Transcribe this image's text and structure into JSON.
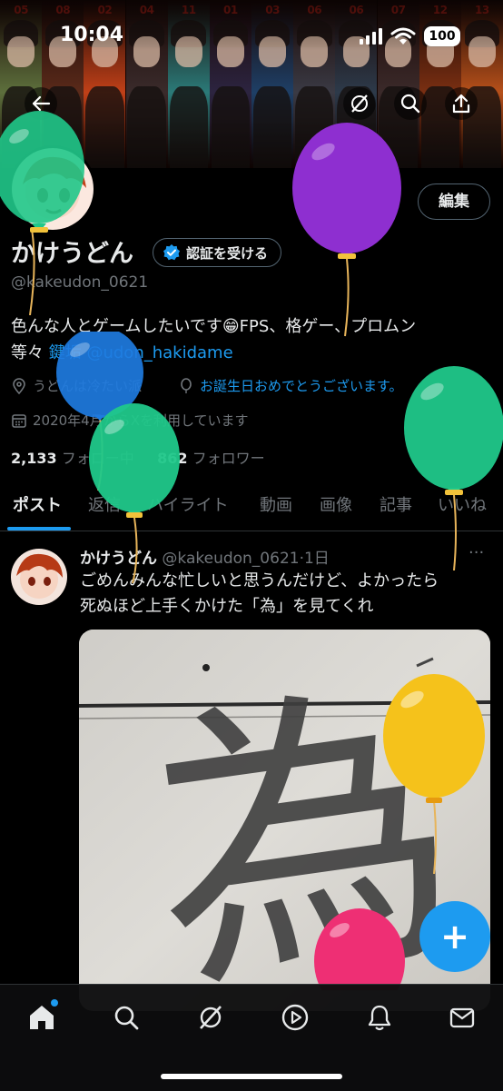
{
  "status_bar": {
    "time": "10:04",
    "battery": "100"
  },
  "banner": {
    "numbers": [
      "05",
      "08",
      "02",
      "04",
      "11",
      "01",
      "03",
      "06",
      "06",
      "07",
      "12",
      "13"
    ],
    "colors": [
      "#5d6f3c",
      "#5a2a1a",
      "#c04018",
      "#3a2b2b",
      "#2b7a78",
      "#2c2440",
      "#1e3f66",
      "#3a3a44",
      "#2d3a4a",
      "#3b2a2a",
      "#7a2f12",
      "#b6501a"
    ]
  },
  "header_icons": [
    "back-arrow-icon",
    "grok-icon",
    "search-icon",
    "share-icon"
  ],
  "profile": {
    "edit_label": "編集",
    "display_name": "かけうどん",
    "verify_label": "認証を受ける",
    "handle": "@kakeudon_0621",
    "bio_line1": "色んな人とゲームしたいです😁FPS、格ゲー、プロムン",
    "bio_line2_prefix": "等々 ",
    "bio_link1": "鍵垢",
    "bio_link2": "@udon_hakidame",
    "location": "うどんは冷たい派",
    "birthday": "お誕生日おめでとうございます。",
    "joined": "2020年4月からXを利用しています",
    "following_count": "2,133",
    "following_label": "フォロー中",
    "followers_count": "862",
    "followers_label": "フォロワー"
  },
  "tabs": [
    "ポスト",
    "返信",
    "ハイライト",
    "動画",
    "画像",
    "記事",
    "いいね"
  ],
  "active_tab": "ポスト",
  "post": {
    "name": "かけうどん",
    "handle": "@kakeudon_0621",
    "time": "·1日",
    "more": "···",
    "text_line1": "ごめんみんな忙しいと思うんだけど、よかったら",
    "text_line2": "死ぬほど上手くかけた「為」を見てくれ",
    "image_character": "為"
  },
  "fab_label": "+",
  "nav": [
    "home-icon",
    "search-icon",
    "grok-icon",
    "video-icon",
    "notifications-icon",
    "messages-icon"
  ],
  "balloon_colors": {
    "green": "#20c88a",
    "purple": "#8e2fd0",
    "blue": "#1e7be0",
    "yellow": "#f5c21b",
    "pink": "#ee2f74"
  },
  "accent_color": "#1d9bf0"
}
